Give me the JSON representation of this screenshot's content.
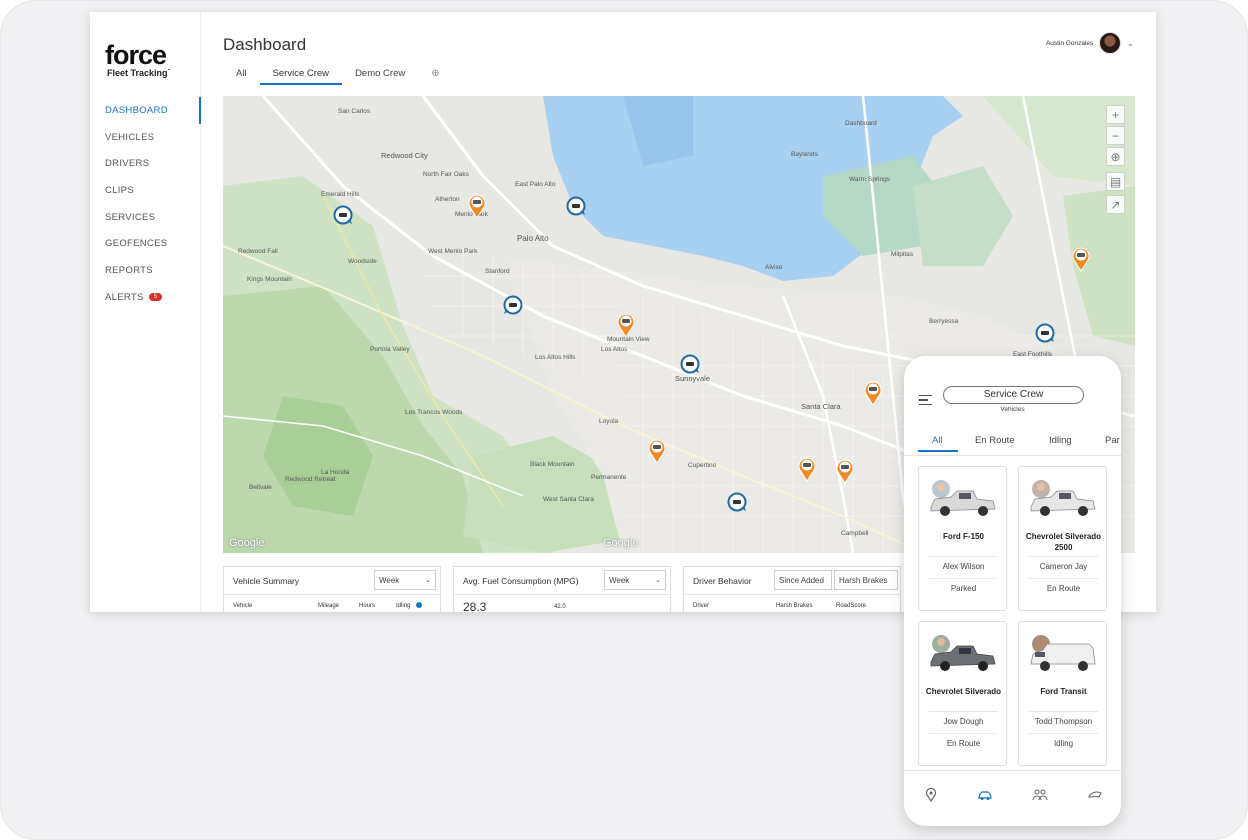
{
  "app": {
    "brand": "force",
    "brand_sub": "Fleet Tracking˙"
  },
  "sidebar": {
    "items": [
      {
        "label": "DASHBOARD",
        "active": true
      },
      {
        "label": "VEHICLES"
      },
      {
        "label": "DRIVERS"
      },
      {
        "label": "CLIPS"
      },
      {
        "label": "SERVICES"
      },
      {
        "label": "GEOFENCES"
      },
      {
        "label": "REPORTS"
      },
      {
        "label": "ALERTS",
        "badge": "5"
      }
    ]
  },
  "header": {
    "title": "Dashboard",
    "user_name": "Austin Gonzales"
  },
  "tabs": [
    {
      "label": "All"
    },
    {
      "label": "Service Crew",
      "active": true
    },
    {
      "label": "Demo Crew"
    },
    {
      "label": "⊕"
    }
  ],
  "map": {
    "attribution": "Google",
    "places": [
      "San Carlos",
      "Redwood City",
      "North Fair Oaks",
      "Emerald Hills",
      "Atherton",
      "Menlo Park",
      "West Menlo Park",
      "Woodside",
      "Stanford",
      "Palo Alto",
      "East Palo Alto",
      "Redwood Fall",
      "Kings Mountain",
      "Portola Valley",
      "Los Altos Hills",
      "Los Altos",
      "Mountain View",
      "Sunnyvale",
      "Santa Clara",
      "Milpitas",
      "Cupertino",
      "Los Trancos Woods",
      "Loyola",
      "Black Mountain",
      "Permanente",
      "West Santa Clara",
      "La Honda",
      "Redwood Retreat",
      "Bellvale",
      "Campbell",
      "Dashboard",
      "Baylands",
      "Warm Springs",
      "East Foothills",
      "Berryessa",
      "Alviso"
    ],
    "controls": [
      "zoom-in",
      "zoom-out",
      "locate",
      "layers",
      "fullscreen"
    ]
  },
  "widgets": [
    {
      "title": "Vehicle Summary",
      "select": "Week",
      "columns": [
        "Vehicle",
        "Mileage",
        "Hours",
        "Idling"
      ]
    },
    {
      "title": "Avg. Fuel Consumption (MPG)",
      "select": "Week",
      "values": [
        "28.3",
        "42.0"
      ]
    },
    {
      "title": "Driver Behavior",
      "select": "Since Added",
      "select2": "Harsh Brakes",
      "columns": [
        "Driver",
        "Harsh Brakes",
        "RoadScore"
      ]
    }
  ],
  "phone": {
    "title": "Service Crew",
    "subtitle": "Vehicles",
    "tabs": [
      "All",
      "En Route",
      "Idling",
      "Par"
    ],
    "cards": [
      {
        "name": "Ford F-150",
        "driver": "Alex Wilson",
        "status": "Parked",
        "color": "#d9d9d9"
      },
      {
        "name": "Chevrolet Silverado 2500",
        "driver": "Cameron Jay",
        "status": "En Route",
        "color": "#e6e6e6"
      },
      {
        "name": "Chevrolet Silverado",
        "driver": "Jow Dough",
        "status": "En Route",
        "color": "#6c6f73"
      },
      {
        "name": "Ford Transit",
        "driver": "Todd Thompson",
        "status": "Idling",
        "color": "#f0f0f0"
      }
    ],
    "bottom_nav": [
      "map-pin-icon",
      "car-icon",
      "group-icon",
      "wheel-icon"
    ]
  },
  "colors": {
    "accent": "#1a73c9",
    "pin_orange": "#f08a24",
    "pin_blue": "#1f6aa5",
    "alert": "#d93025"
  }
}
